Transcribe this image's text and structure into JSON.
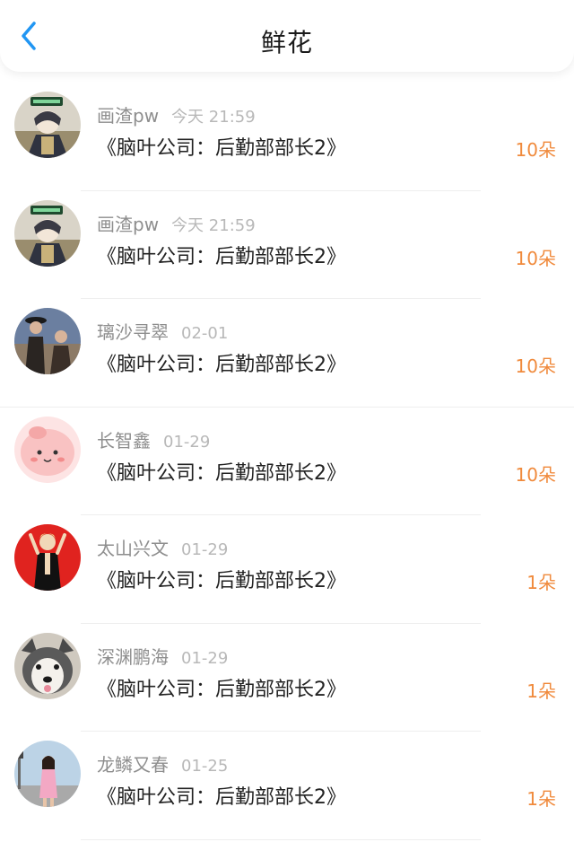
{
  "header": {
    "title": "鲜花",
    "back_icon": "chevron-left-icon",
    "accent": "#2196f3"
  },
  "colors": {
    "count": "#f08a3c",
    "name": "#8e8e8e",
    "time": "#b8b8b8"
  },
  "items": [
    {
      "name": "画渣pw",
      "time": "今天 21:59",
      "work": "《脑叶公司：后勤部部长2》",
      "count": "10朵",
      "avatar": "anime-character-avatar"
    },
    {
      "name": "画渣pw",
      "time": "今天 21:59",
      "work": "《脑叶公司：后勤部部长2》",
      "count": "10朵",
      "avatar": "anime-character-avatar"
    },
    {
      "name": "璃沙寻翠",
      "time": "02-01",
      "work": "《脑叶公司：后勤部部长2》",
      "count": "10朵",
      "avatar": "couple-photo-avatar"
    },
    {
      "name": "长智鑫",
      "time": "01-29",
      "work": "《脑叶公司：后勤部部长2》",
      "count": "10朵",
      "avatar": "pink-cartoon-avatar"
    },
    {
      "name": "太山兴文",
      "time": "01-29",
      "work": "《脑叶公司：后勤部部长2》",
      "count": "1朵",
      "avatar": "red-figure-avatar"
    },
    {
      "name": "深渊鹏海",
      "time": "01-29",
      "work": "《脑叶公司：后勤部部长2》",
      "count": "1朵",
      "avatar": "husky-dog-avatar"
    },
    {
      "name": "龙鳞又春",
      "time": "01-25",
      "work": "《脑叶公司：后勤部部长2》",
      "count": "1朵",
      "avatar": "street-photo-avatar"
    }
  ]
}
